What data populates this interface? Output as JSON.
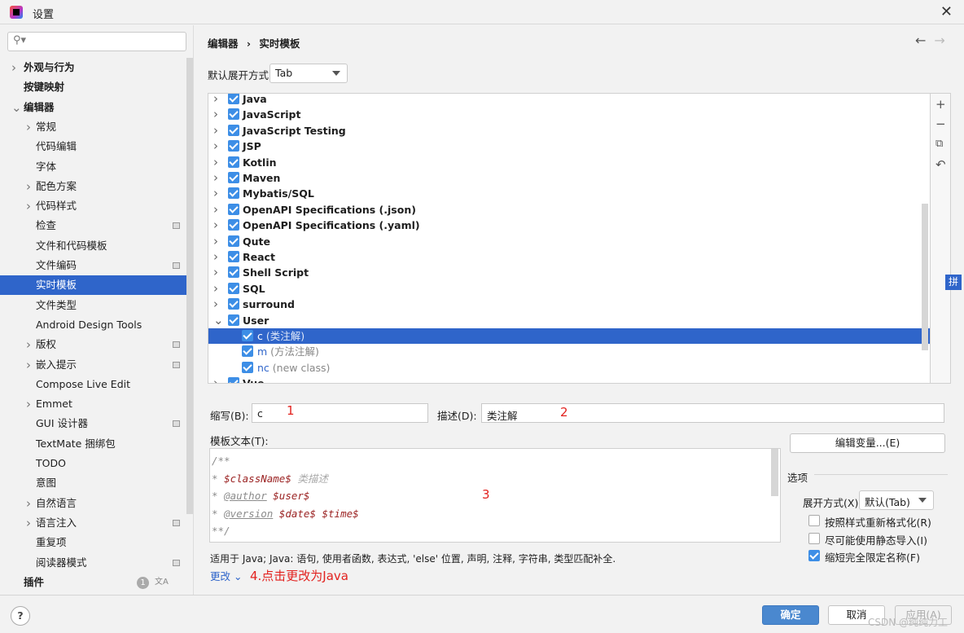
{
  "window": {
    "title": "设置",
    "close": "✕"
  },
  "sidebar": {
    "search_placeholder": "",
    "items": [
      {
        "label": "外观与行为",
        "level": 0,
        "chevron": "right",
        "bold": true
      },
      {
        "label": "按键映射",
        "level": 0,
        "bold": true
      },
      {
        "label": "编辑器",
        "level": 0,
        "chevron": "down",
        "bold": true
      },
      {
        "label": "常规",
        "level": 1,
        "chevron": "right"
      },
      {
        "label": "代码编辑",
        "level": 1
      },
      {
        "label": "字体",
        "level": 1
      },
      {
        "label": "配色方案",
        "level": 1,
        "chevron": "right"
      },
      {
        "label": "代码样式",
        "level": 1,
        "chevron": "right"
      },
      {
        "label": "检查",
        "level": 1,
        "badge": true
      },
      {
        "label": "文件和代码模板",
        "level": 1
      },
      {
        "label": "文件编码",
        "level": 1,
        "badge": true
      },
      {
        "label": "实时模板",
        "level": 1,
        "selected": true
      },
      {
        "label": "文件类型",
        "level": 1
      },
      {
        "label": "Android Design Tools",
        "level": 1
      },
      {
        "label": "版权",
        "level": 1,
        "chevron": "right",
        "badge": true
      },
      {
        "label": "嵌入提示",
        "level": 1,
        "chevron": "right",
        "badge": true
      },
      {
        "label": "Compose Live Edit",
        "level": 1
      },
      {
        "label": "Emmet",
        "level": 1,
        "chevron": "right"
      },
      {
        "label": "GUI 设计器",
        "level": 1,
        "badge": true
      },
      {
        "label": "TextMate 捆绑包",
        "level": 1
      },
      {
        "label": "TODO",
        "level": 1
      },
      {
        "label": "意图",
        "level": 1
      },
      {
        "label": "自然语言",
        "level": 1,
        "chevron": "right"
      },
      {
        "label": "语言注入",
        "level": 1,
        "chevron": "right",
        "badge": true
      },
      {
        "label": "重复项",
        "level": 1
      },
      {
        "label": "阅读器模式",
        "level": 1,
        "badge": true
      },
      {
        "label": "插件",
        "level": 0,
        "bold": true,
        "count": "1"
      }
    ]
  },
  "header": {
    "breadcrumb": [
      "编辑器",
      "›",
      "实时模板"
    ],
    "back": "←",
    "forward": "→"
  },
  "default_expand": {
    "label": "默认展开方式",
    "value": "Tab"
  },
  "tree": [
    {
      "label": "Java",
      "checked": true
    },
    {
      "label": "JavaScript",
      "checked": true
    },
    {
      "label": "JavaScript Testing",
      "checked": true
    },
    {
      "label": "JSP",
      "checked": true
    },
    {
      "label": "Kotlin",
      "checked": true
    },
    {
      "label": "Maven",
      "checked": true
    },
    {
      "label": "Mybatis/SQL",
      "checked": true
    },
    {
      "label": "OpenAPI Specifications (.json)",
      "checked": true
    },
    {
      "label": "OpenAPI Specifications (.yaml)",
      "checked": true
    },
    {
      "label": "Qute",
      "checked": true
    },
    {
      "label": "React",
      "checked": true
    },
    {
      "label": "Shell Script",
      "checked": true
    },
    {
      "label": "SQL",
      "checked": true
    },
    {
      "label": "surround",
      "checked": true
    },
    {
      "label": "User",
      "checked": true,
      "expanded": true
    },
    {
      "abbr": "c",
      "desc": "(类注解)",
      "checked": true,
      "child": true,
      "selected": true
    },
    {
      "abbr": "m",
      "desc": "(方法注解)",
      "checked": true,
      "child": true
    },
    {
      "abbr": "nc",
      "desc": "(new class)",
      "checked": true,
      "child": true
    },
    {
      "label": "Vue",
      "checked": true
    }
  ],
  "tree_tools": {
    "add": "+",
    "remove": "−",
    "copy": "⧉",
    "restore": "↶"
  },
  "ime_indicator": "拼",
  "form": {
    "abbr_label": "缩写(B):",
    "abbr_value": "c",
    "desc_label": "描述(D):",
    "desc_value": "类注解",
    "template_label": "模板文本(T):",
    "template_lines": [
      "/**",
      " * $className$ 类描述",
      " * @author $user$",
      " * @version $date$ $time$",
      "**/"
    ],
    "edit_vars": "编辑变量...(E)",
    "applies": "适用于 Java; Java: 语句, 使用者函数, 表达式, 'else' 位置, 声明, 注释, 字符串, 类型匹配补全.",
    "change": "更改 ⌄"
  },
  "options": {
    "title": "选项",
    "expand_label": "展开方式(X)",
    "expand_value": "默认(Tab)",
    "checkboxes": [
      {
        "label": "按照样式重新格式化(R)",
        "checked": false
      },
      {
        "label": "尽可能使用静态导入(I)",
        "checked": false
      },
      {
        "label": "缩短完全限定名称(F)",
        "checked": true
      }
    ]
  },
  "annotations": [
    "1",
    "2",
    "3",
    "4.点击更改为Java"
  ],
  "footer": {
    "help": "?",
    "ok": "确定",
    "cancel": "取消",
    "apply": "应用(A)"
  },
  "watermark": "CSDN @纯纯力工",
  "colors": {
    "accent": "#2f65ca",
    "annotation": "#e2221f",
    "checkbox": "#3d8ee6"
  }
}
